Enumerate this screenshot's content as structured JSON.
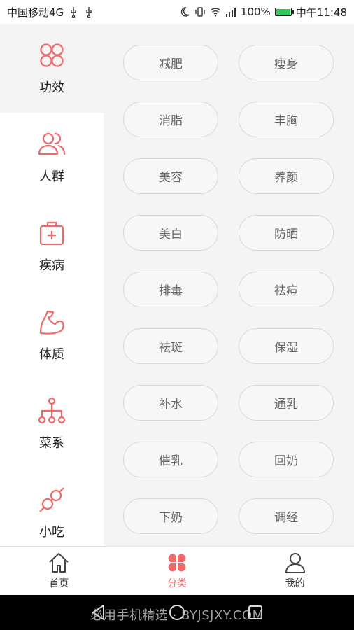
{
  "status_bar": {
    "carrier": "中国移动4G",
    "battery_percent": "100%",
    "time": "中午11:48",
    "icons": [
      "usb-icon",
      "usb-icon",
      "moon-icon",
      "vibrate-icon",
      "wifi-icon",
      "signal-icon",
      "battery-icon"
    ]
  },
  "sidebar": {
    "items": [
      {
        "label": "功效",
        "icon": "four-circles-icon"
      },
      {
        "label": "人群",
        "icon": "people-icon"
      },
      {
        "label": "疾病",
        "icon": "medkit-icon"
      },
      {
        "label": "体质",
        "icon": "bicep-icon"
      },
      {
        "label": "菜系",
        "icon": "tree-network-icon"
      },
      {
        "label": "小吃",
        "icon": "skewer-icon"
      }
    ],
    "active_index": 0
  },
  "tags": [
    "减肥",
    "瘦身",
    "消脂",
    "丰胸",
    "美容",
    "养颜",
    "美白",
    "防晒",
    "排毒",
    "祛痘",
    "祛斑",
    "保湿",
    "补水",
    "通乳",
    "催乳",
    "回奶",
    "下奶",
    "调经"
  ],
  "tabbar": {
    "items": [
      {
        "label": "首页",
        "icon": "home-icon"
      },
      {
        "label": "分类",
        "icon": "clover-icon"
      },
      {
        "label": "我的",
        "icon": "user-icon"
      }
    ],
    "active_index": 1
  },
  "watermark": "必用手机精选 · BYJSJXY.COM",
  "colors": {
    "accent": "#ee6a6a",
    "sidebar_active_bg": "#f4f4f4",
    "tag_border": "#d6d6d6",
    "tag_text": "#666666"
  }
}
